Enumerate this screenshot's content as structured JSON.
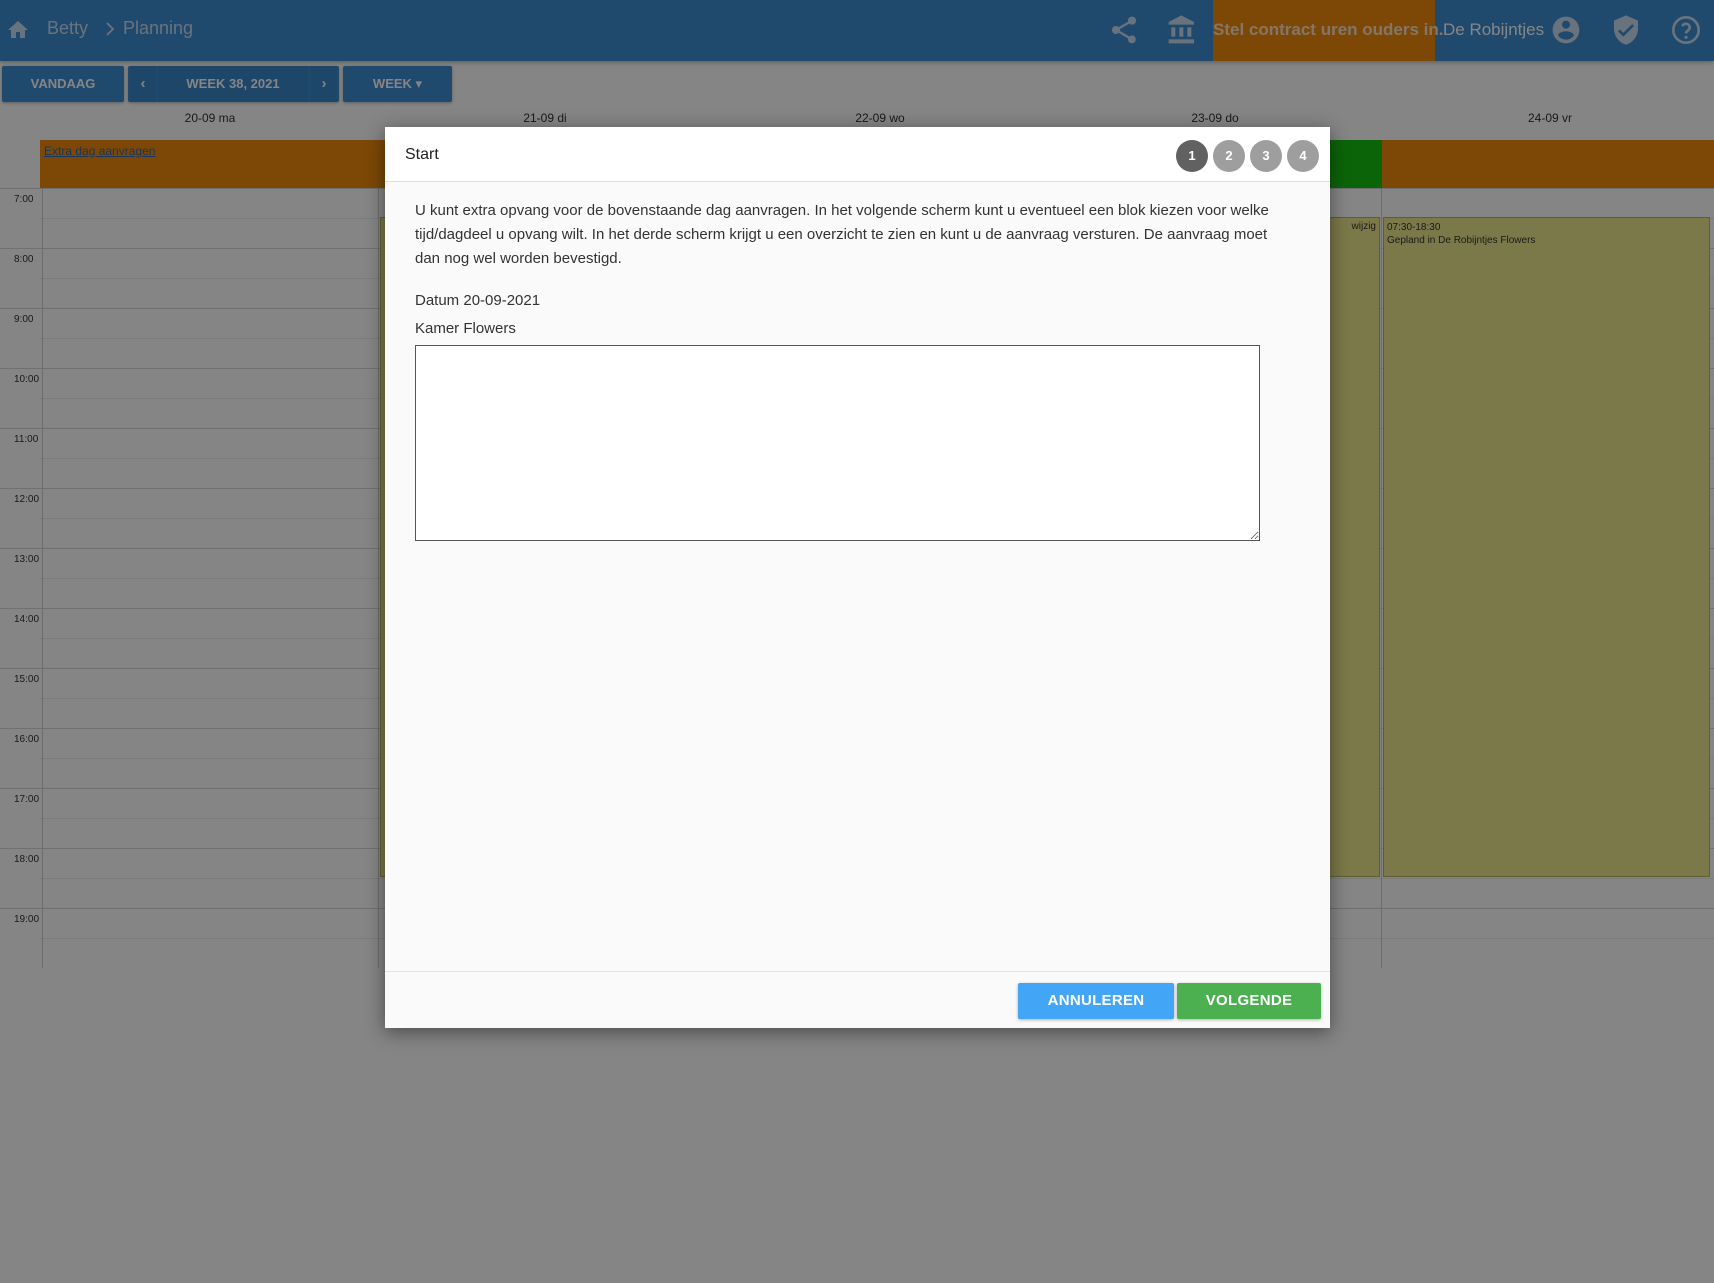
{
  "topbar": {
    "breadcrumb": [
      "Betty",
      "Planning"
    ],
    "contract_label": "Stel contract uren ouders in.",
    "org_name": "De Robijntjes",
    "colors": {
      "bar": "#3f8fd2",
      "contract": "#f08a0b"
    }
  },
  "toolbar": {
    "today_label": "VANDAAG",
    "prev_label": "‹",
    "week_label": "WEEK 38, 2021",
    "next_label": "›",
    "view_label": "WEEK ▾"
  },
  "calendar": {
    "days": [
      "20-09 ma",
      "21-09 di",
      "22-09 wo",
      "23-09 do",
      "24-09 vr"
    ],
    "extra_link": "Extra dag aanvragen",
    "hours": [
      "7:00",
      "8:00",
      "9:00",
      "10:00",
      "11:00",
      "12:00",
      "13:00",
      "14:00",
      "15:00",
      "16:00",
      "17:00",
      "18:00",
      "19:00"
    ],
    "event_thursday_action": "wijzig",
    "event_friday_time": "07:30-18:30",
    "event_friday_text": "Gepland in De Robijntjes Flowers"
  },
  "modal": {
    "title": "Start",
    "steps": [
      "1",
      "2",
      "3",
      "4"
    ],
    "active_step": 1,
    "intro": "U kunt extra opvang voor de bovenstaande dag aanvragen. In het volgende scherm kunt u eventueel een blok kiezen voor welke tijd/dagdeel u opvang wilt. In het derde scherm krijgt u een overzicht te zien en kunt u de aanvraag versturen. De aanvraag moet dan nog wel worden bevestigd.",
    "date_line": "Datum 20-09-2021",
    "room_line": "Kamer Flowers",
    "note_value": "",
    "cancel_label": "ANNULEREN",
    "next_label": "VOLGENDE",
    "colors": {
      "cancel": "#42a5f5",
      "next": "#4caf50"
    }
  }
}
